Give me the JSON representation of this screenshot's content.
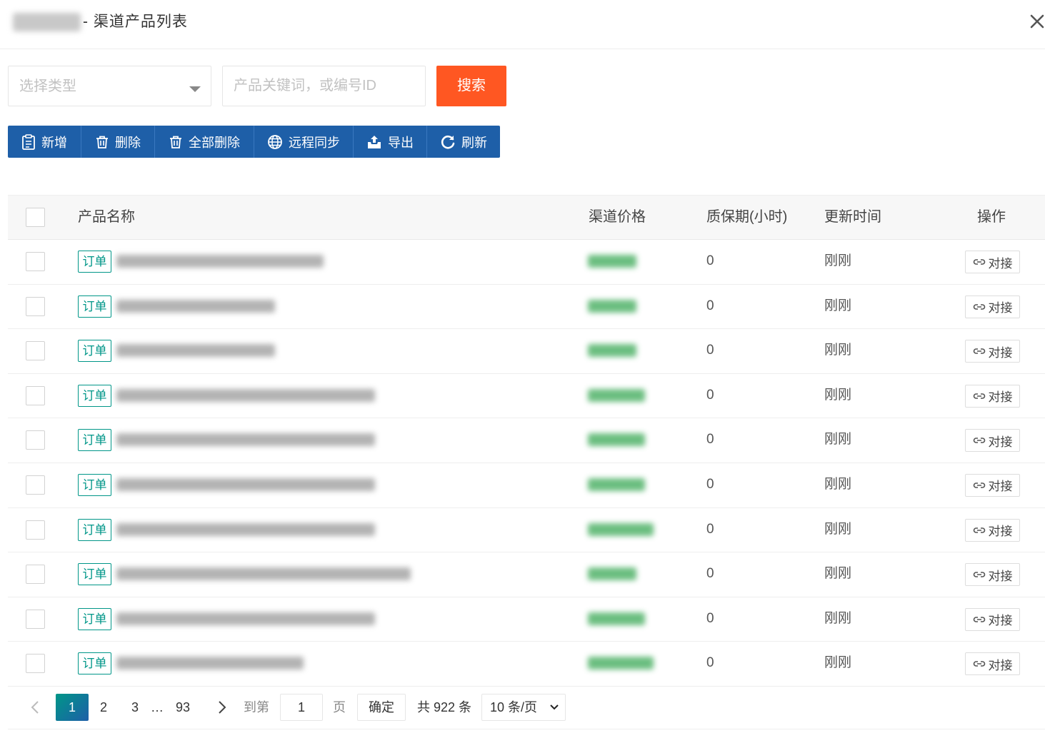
{
  "dialog": {
    "title": "- 渠道产品列表"
  },
  "filters": {
    "type_placeholder": "选择类型",
    "keyword_placeholder": "产品关键词，或编号ID",
    "search_label": "搜索"
  },
  "toolbar": {
    "add": "新增",
    "delete": "删除",
    "delete_all": "全部删除",
    "remote_sync": "远程同步",
    "export": "导出",
    "refresh": "刷新"
  },
  "table": {
    "columns": [
      "产品名称",
      "渠道价格",
      "质保期(小时)",
      "更新时间",
      "操作"
    ],
    "rows": [
      {
        "tag": "订单",
        "warranty": "0",
        "updated": "刚刚",
        "action": "对接"
      },
      {
        "tag": "订单",
        "warranty": "0",
        "updated": "刚刚",
        "action": "对接"
      },
      {
        "tag": "订单",
        "warranty": "0",
        "updated": "刚刚",
        "action": "对接"
      },
      {
        "tag": "订单",
        "warranty": "0",
        "updated": "刚刚",
        "action": "对接"
      },
      {
        "tag": "订单",
        "warranty": "0",
        "updated": "刚刚",
        "action": "对接"
      },
      {
        "tag": "订单",
        "warranty": "0",
        "updated": "刚刚",
        "action": "对接"
      },
      {
        "tag": "订单",
        "warranty": "0",
        "updated": "刚刚",
        "action": "对接"
      },
      {
        "tag": "订单",
        "warranty": "0",
        "updated": "刚刚",
        "action": "对接"
      },
      {
        "tag": "订单",
        "warranty": "0",
        "updated": "刚刚",
        "action": "对接"
      },
      {
        "tag": "订单",
        "warranty": "0",
        "updated": "刚刚",
        "action": "对接"
      }
    ]
  },
  "pagination": {
    "pages": [
      "1",
      "2",
      "3",
      "…",
      "93"
    ],
    "current": "1",
    "goto_label": "到第",
    "goto_value": "1",
    "page_suffix": "页",
    "confirm": "确定",
    "total": "共 922 条",
    "page_size": "10 条/页"
  },
  "colors": {
    "primary": "#1e5fa8",
    "search": "#ff5722",
    "tag": "#009688",
    "price": "#52b36a"
  }
}
